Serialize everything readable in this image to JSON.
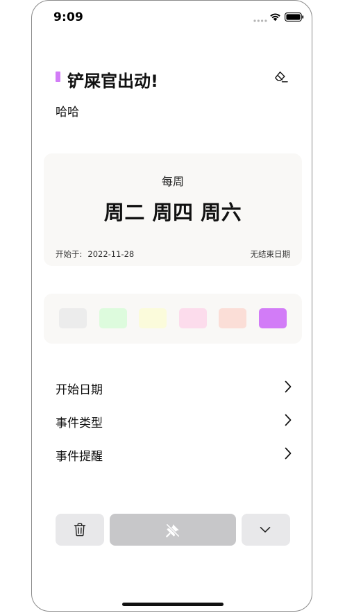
{
  "status_bar": {
    "time": "9:09"
  },
  "event": {
    "title": "铲屎官出动!",
    "note": "哈哈",
    "marker_color": "#d27cf7"
  },
  "repeat": {
    "frequency": "每周",
    "days": "周二 周四 周六",
    "start_label": "开始于:",
    "start_date": "2022-11-28",
    "end_text": "无结束日期"
  },
  "colors": {
    "swatches": [
      "#ececec",
      "#ddfbdd",
      "#fbfbdb",
      "#fcdcec",
      "#fbded7",
      "#d27cf7"
    ],
    "selected": "#d27cf7"
  },
  "menu": {
    "items": [
      {
        "label": "开始日期"
      },
      {
        "label": "事件类型"
      },
      {
        "label": "事件提醒"
      }
    ]
  },
  "actions": {
    "delete_icon": "trash-icon",
    "pin_icon": "pin-off-icon",
    "more_icon": "chevron-down-icon"
  }
}
